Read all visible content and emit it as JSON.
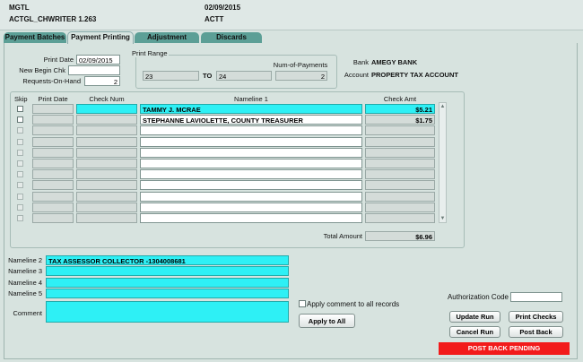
{
  "header": {
    "site": "MGTL",
    "module": "ACTGL_CHWRITER 1.263",
    "date": "02/09/2015",
    "code": "ACTT"
  },
  "tabs": [
    {
      "label": "Payment Batches"
    },
    {
      "label": "Payment Printing"
    },
    {
      "label": "Adjustment"
    },
    {
      "label": "Discards"
    }
  ],
  "form": {
    "print_date_label": "Print Date",
    "print_date": "02/09/2015",
    "new_begin_chk_label": "New Begin Chk",
    "new_begin_chk": "",
    "requests_on_hand_label": "Requests-On-Hand",
    "requests_on_hand": "2",
    "print_range_label": "Print Range",
    "range_from": "23",
    "to_label": "TO",
    "range_to": "24",
    "num_payments_label": "Num-of-Payments",
    "num_payments": "2",
    "bank_label": "Bank",
    "bank": "AMEGY BANK",
    "account_label": "Account",
    "account": "PROPERTY TAX ACCOUNT"
  },
  "grid": {
    "columns": {
      "skip": "Skip",
      "print_date": "Print Date",
      "check_num": "Check Num",
      "nameline1": "Nameline 1",
      "check_amt": "Check Amt"
    },
    "rows": [
      {
        "name": "TAMMY J. MCRAE",
        "amt": "$5.21"
      },
      {
        "name": "STEPHANNE LAVIOLETTE, COUNTY TREASURER",
        "amt": "$1.75"
      },
      {
        "name": "",
        "amt": ""
      },
      {
        "name": "",
        "amt": ""
      },
      {
        "name": "",
        "amt": ""
      },
      {
        "name": "",
        "amt": ""
      },
      {
        "name": "",
        "amt": ""
      },
      {
        "name": "",
        "amt": ""
      },
      {
        "name": "",
        "amt": ""
      },
      {
        "name": "",
        "amt": ""
      },
      {
        "name": "",
        "amt": ""
      }
    ],
    "total_label": "Total Amount",
    "total": "$6.96"
  },
  "detail": {
    "nameline2_label": "Nameline 2",
    "nameline2": "TAX ASSESSOR COLLECTOR -1304008681",
    "nameline3_label": "Nameline 3",
    "nameline3": "",
    "nameline4_label": "Nameline 4",
    "nameline4": "",
    "nameline5_label": "Nameline 5",
    "nameline5": "",
    "comment_label": "Comment",
    "comment": "",
    "apply_comment_label": "Apply comment to all records",
    "apply_to_all": "Apply to All",
    "auth_code_label": "Authorization Code",
    "auth_code": ""
  },
  "buttons": {
    "update_run": "Update Run",
    "print_checks": "Print Checks",
    "cancel_run": "Cancel Run",
    "post_back": "Post Back"
  },
  "status": {
    "post_back_pending": "POST BACK PENDING"
  },
  "colors": {
    "accent_cyan": "#2ef0f5",
    "tab_teal": "#5c9f96",
    "status_red": "#f21b1b"
  }
}
